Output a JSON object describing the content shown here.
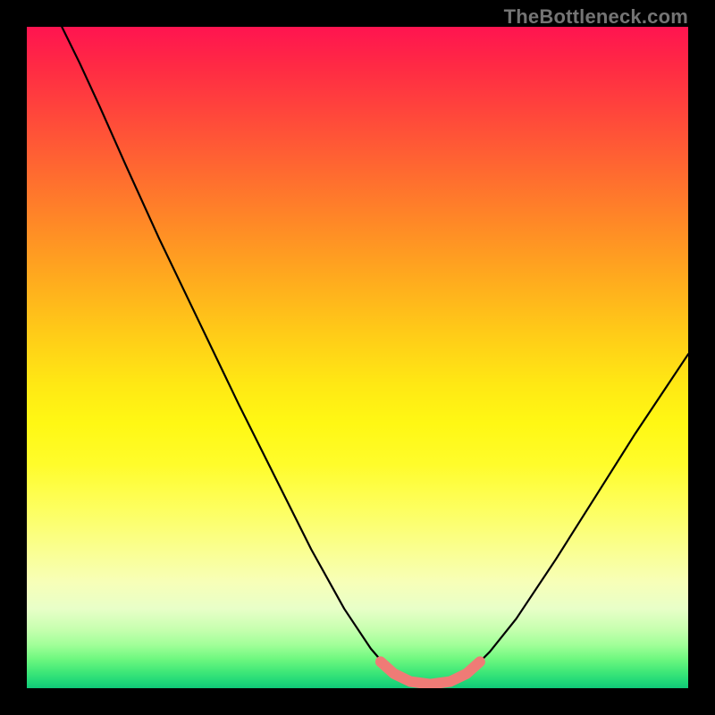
{
  "watermark": "TheBottleneck.com",
  "colors": {
    "curve": "#000000",
    "highlight": "#ef7b76",
    "frame": "#000000"
  },
  "chart_data": {
    "type": "line",
    "title": "",
    "xlabel": "",
    "ylabel": "",
    "xlim": [
      0,
      1
    ],
    "ylim": [
      0,
      1
    ],
    "description": "V-shaped bottleneck curve on a rainbow heat gradient. Left branch descends steeply from top-left to a flat valley near x≈0.6, right branch rises with decreasing slope toward upper-right. A short salmon overlay marks the flat valley segment.",
    "series": [
      {
        "name": "bottleneck-curve",
        "color": "#000000",
        "points": [
          {
            "x": 0.053,
            "y": 1.0
          },
          {
            "x": 0.08,
            "y": 0.945
          },
          {
            "x": 0.11,
            "y": 0.88
          },
          {
            "x": 0.15,
            "y": 0.79
          },
          {
            "x": 0.2,
            "y": 0.68
          },
          {
            "x": 0.26,
            "y": 0.555
          },
          {
            "x": 0.32,
            "y": 0.43
          },
          {
            "x": 0.38,
            "y": 0.31
          },
          {
            "x": 0.43,
            "y": 0.21
          },
          {
            "x": 0.48,
            "y": 0.12
          },
          {
            "x": 0.52,
            "y": 0.06
          },
          {
            "x": 0.55,
            "y": 0.025
          },
          {
            "x": 0.58,
            "y": 0.01
          },
          {
            "x": 0.61,
            "y": 0.006
          },
          {
            "x": 0.64,
            "y": 0.01
          },
          {
            "x": 0.67,
            "y": 0.025
          },
          {
            "x": 0.7,
            "y": 0.055
          },
          {
            "x": 0.74,
            "y": 0.105
          },
          {
            "x": 0.8,
            "y": 0.195
          },
          {
            "x": 0.86,
            "y": 0.29
          },
          {
            "x": 0.92,
            "y": 0.385
          },
          {
            "x": 0.97,
            "y": 0.46
          },
          {
            "x": 1.0,
            "y": 0.505
          }
        ]
      },
      {
        "name": "valley-highlight",
        "color": "#ef7b76",
        "points": [
          {
            "x": 0.535,
            "y": 0.04
          },
          {
            "x": 0.555,
            "y": 0.022
          },
          {
            "x": 0.58,
            "y": 0.01
          },
          {
            "x": 0.61,
            "y": 0.006
          },
          {
            "x": 0.64,
            "y": 0.01
          },
          {
            "x": 0.665,
            "y": 0.022
          },
          {
            "x": 0.685,
            "y": 0.04
          }
        ]
      }
    ]
  }
}
